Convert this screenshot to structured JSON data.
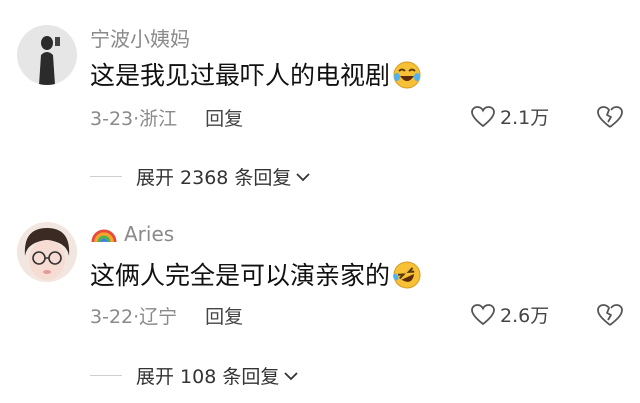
{
  "comments": [
    {
      "username": "宁波小姨妈",
      "text": "这是我见过最吓人的电视剧",
      "emoji": "crying-laughing-emoji",
      "date": "3-23·浙江",
      "reply_label": "回复",
      "likes": "2.1万",
      "expand_label": "展开 2368 条回复"
    },
    {
      "flag_icon": "rainbow-icon",
      "username": "Aries",
      "text": "这俩人完全是可以演亲家的",
      "emoji": "rolling-laughing-emoji",
      "date": "3-22·辽宁",
      "reply_label": "回复",
      "likes": "2.6万",
      "expand_label": "展开 108 条回复"
    }
  ],
  "colors": {
    "muted": "#8a8a8a",
    "text": "#111111",
    "emoji_yellow": "#f7c137"
  }
}
